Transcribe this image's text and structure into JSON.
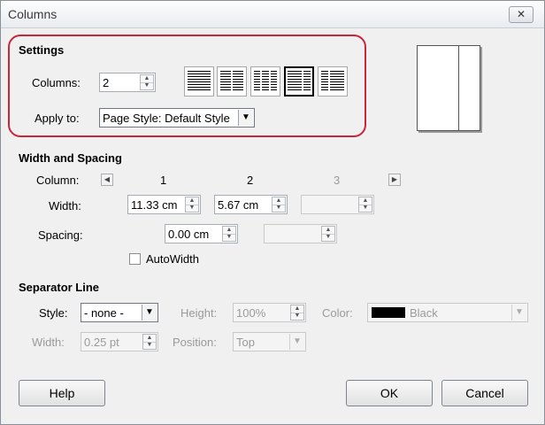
{
  "window": {
    "title": "Columns",
    "close_glyph": "✕"
  },
  "settings": {
    "header": "Settings",
    "columns_label": "Columns:",
    "columns_value": "2",
    "apply_to_label": "Apply to:",
    "apply_to_value": "Page Style: Default Style",
    "highlight_color": "#c8263a"
  },
  "width_spacing": {
    "header": "Width and Spacing",
    "column_label": "Column:",
    "col_numbers": [
      "1",
      "2",
      "3"
    ],
    "width_label": "Width:",
    "widths": [
      "11.33 cm",
      "5.67 cm",
      ""
    ],
    "spacing_label": "Spacing:",
    "spacings": [
      "0.00 cm",
      ""
    ],
    "autowidth_label": "AutoWidth"
  },
  "separator": {
    "header": "Separator Line",
    "style_label": "Style:",
    "style_value": "- none -",
    "height_label": "Height:",
    "height_value": "100%",
    "color_label": "Color:",
    "color_value": "Black",
    "color_swatch": "#000000",
    "width_label": "Width:",
    "width_value": "0.25 pt",
    "position_label": "Position:",
    "position_value": "Top"
  },
  "buttons": {
    "help": "Help",
    "ok": "OK",
    "cancel": "Cancel"
  }
}
